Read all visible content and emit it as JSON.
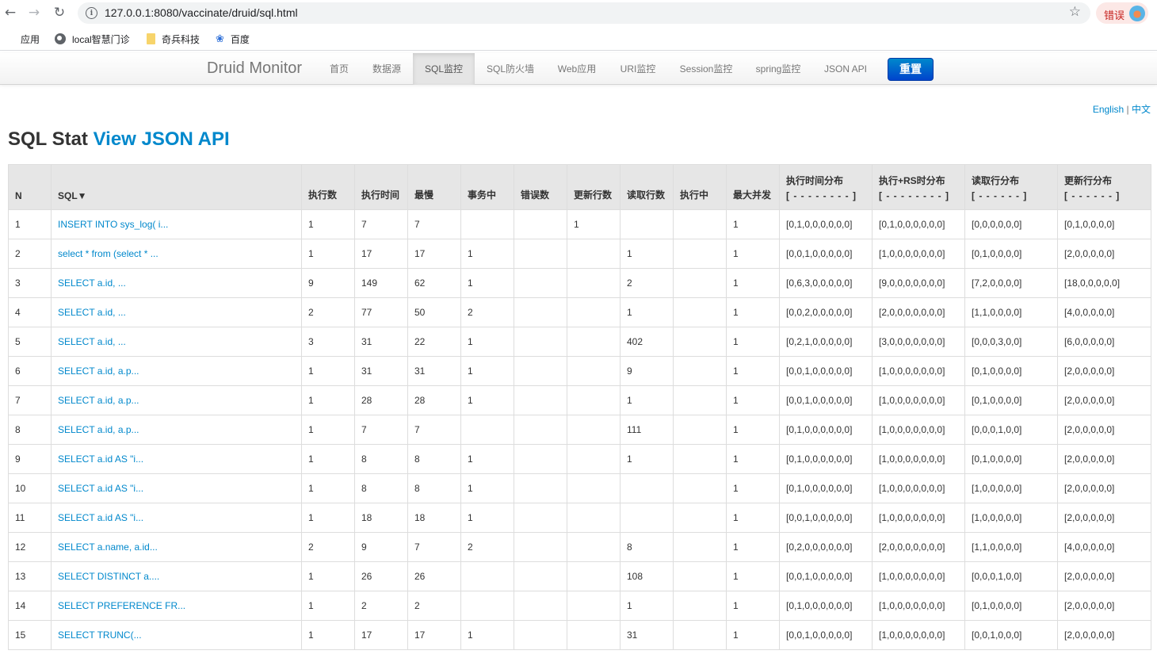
{
  "browser": {
    "url": "127.0.0.1:8080/vaccinate/druid/sql.html",
    "error_label": "错误",
    "bookmarks": [
      {
        "label": "应用",
        "icon": "apps-grid-icon"
      },
      {
        "label": "local智慧门诊",
        "icon": "globe-icon"
      },
      {
        "label": "奇兵科技",
        "icon": "folder-icon"
      },
      {
        "label": "百度",
        "icon": "paw-icon"
      }
    ]
  },
  "nav": {
    "brand": "Druid Monitor",
    "items": [
      "首页",
      "数据源",
      "SQL监控",
      "SQL防火墙",
      "Web应用",
      "URI监控",
      "Session监控",
      "spring监控",
      "JSON API"
    ],
    "active_index": 2,
    "reset_label": "重置"
  },
  "lang": {
    "english": "English",
    "sep": " | ",
    "chinese": "中文"
  },
  "title": {
    "main": "SQL Stat ",
    "link": "View JSON API"
  },
  "table": {
    "headers": [
      {
        "label": "N"
      },
      {
        "label": "SQL▼"
      },
      {
        "label": "执行数"
      },
      {
        "label": "执行时间"
      },
      {
        "label": "最慢"
      },
      {
        "label": "事务中"
      },
      {
        "label": "错误数"
      },
      {
        "label": "更新行数"
      },
      {
        "label": "读取行数"
      },
      {
        "label": "执行中"
      },
      {
        "label": "最大并发"
      },
      {
        "label": "执行时间分布",
        "sub": "[ - - - - - - - - ]"
      },
      {
        "label": "执行+RS时分布",
        "sub": "[ - - - - - - - - ]"
      },
      {
        "label": "读取行分布",
        "sub": "[ - - - - - - ]"
      },
      {
        "label": "更新行分布",
        "sub": "[ - - - - - - ]"
      }
    ],
    "rows": [
      [
        "1",
        "INSERT INTO sys_log( i...",
        "1",
        "7",
        "7",
        "",
        "",
        "1",
        "",
        "",
        "1",
        "[0,1,0,0,0,0,0,0]",
        "[0,1,0,0,0,0,0,0]",
        "[0,0,0,0,0,0]",
        "[0,1,0,0,0,0]"
      ],
      [
        "2",
        "select * from (select * ...",
        "1",
        "17",
        "17",
        "1",
        "",
        "",
        "1",
        "",
        "1",
        "[0,0,1,0,0,0,0,0]",
        "[1,0,0,0,0,0,0,0]",
        "[0,1,0,0,0,0]",
        "[2,0,0,0,0,0]"
      ],
      [
        "3",
        "SELECT a.id, ...",
        "9",
        "149",
        "62",
        "1",
        "",
        "",
        "2",
        "",
        "1",
        "[0,6,3,0,0,0,0,0]",
        "[9,0,0,0,0,0,0,0]",
        "[7,2,0,0,0,0]",
        "[18,0,0,0,0,0]"
      ],
      [
        "4",
        "SELECT a.id, ...",
        "2",
        "77",
        "50",
        "2",
        "",
        "",
        "1",
        "",
        "1",
        "[0,0,2,0,0,0,0,0]",
        "[2,0,0,0,0,0,0,0]",
        "[1,1,0,0,0,0]",
        "[4,0,0,0,0,0]"
      ],
      [
        "5",
        "SELECT a.id, ...",
        "3",
        "31",
        "22",
        "1",
        "",
        "",
        "402",
        "",
        "1",
        "[0,2,1,0,0,0,0,0]",
        "[3,0,0,0,0,0,0,0]",
        "[0,0,0,3,0,0]",
        "[6,0,0,0,0,0]"
      ],
      [
        "6",
        "SELECT a.id, a.p...",
        "1",
        "31",
        "31",
        "1",
        "",
        "",
        "9",
        "",
        "1",
        "[0,0,1,0,0,0,0,0]",
        "[1,0,0,0,0,0,0,0]",
        "[0,1,0,0,0,0]",
        "[2,0,0,0,0,0]"
      ],
      [
        "7",
        "SELECT a.id, a.p...",
        "1",
        "28",
        "28",
        "1",
        "",
        "",
        "1",
        "",
        "1",
        "[0,0,1,0,0,0,0,0]",
        "[1,0,0,0,0,0,0,0]",
        "[0,1,0,0,0,0]",
        "[2,0,0,0,0,0]"
      ],
      [
        "8",
        "SELECT a.id, a.p...",
        "1",
        "7",
        "7",
        "",
        "",
        "",
        "111",
        "",
        "1",
        "[0,1,0,0,0,0,0,0]",
        "[1,0,0,0,0,0,0,0]",
        "[0,0,0,1,0,0]",
        "[2,0,0,0,0,0]"
      ],
      [
        "9",
        "SELECT a.id AS \"i...",
        "1",
        "8",
        "8",
        "1",
        "",
        "",
        "1",
        "",
        "1",
        "[0,1,0,0,0,0,0,0]",
        "[1,0,0,0,0,0,0,0]",
        "[0,1,0,0,0,0]",
        "[2,0,0,0,0,0]"
      ],
      [
        "10",
        "SELECT a.id AS \"i...",
        "1",
        "8",
        "8",
        "1",
        "",
        "",
        "",
        "",
        "1",
        "[0,1,0,0,0,0,0,0]",
        "[1,0,0,0,0,0,0,0]",
        "[1,0,0,0,0,0]",
        "[2,0,0,0,0,0]"
      ],
      [
        "11",
        "SELECT a.id AS \"i...",
        "1",
        "18",
        "18",
        "1",
        "",
        "",
        "",
        "",
        "1",
        "[0,0,1,0,0,0,0,0]",
        "[1,0,0,0,0,0,0,0]",
        "[1,0,0,0,0,0]",
        "[2,0,0,0,0,0]"
      ],
      [
        "12",
        "SELECT a.name, a.id...",
        "2",
        "9",
        "7",
        "2",
        "",
        "",
        "8",
        "",
        "1",
        "[0,2,0,0,0,0,0,0]",
        "[2,0,0,0,0,0,0,0]",
        "[1,1,0,0,0,0]",
        "[4,0,0,0,0,0]"
      ],
      [
        "13",
        "SELECT DISTINCT a....",
        "1",
        "26",
        "26",
        "",
        "",
        "",
        "108",
        "",
        "1",
        "[0,0,1,0,0,0,0,0]",
        "[1,0,0,0,0,0,0,0]",
        "[0,0,0,1,0,0]",
        "[2,0,0,0,0,0]"
      ],
      [
        "14",
        "SELECT PREFERENCE FR...",
        "1",
        "2",
        "2",
        "",
        "",
        "",
        "1",
        "",
        "1",
        "[0,1,0,0,0,0,0,0]",
        "[1,0,0,0,0,0,0,0]",
        "[0,1,0,0,0,0]",
        "[2,0,0,0,0,0]"
      ],
      [
        "15",
        "SELECT TRUNC(...",
        "1",
        "17",
        "17",
        "1",
        "",
        "",
        "31",
        "",
        "1",
        "[0,0,1,0,0,0,0,0]",
        "[1,0,0,0,0,0,0,0]",
        "[0,0,1,0,0,0]",
        "[2,0,0,0,0,0]"
      ]
    ]
  }
}
